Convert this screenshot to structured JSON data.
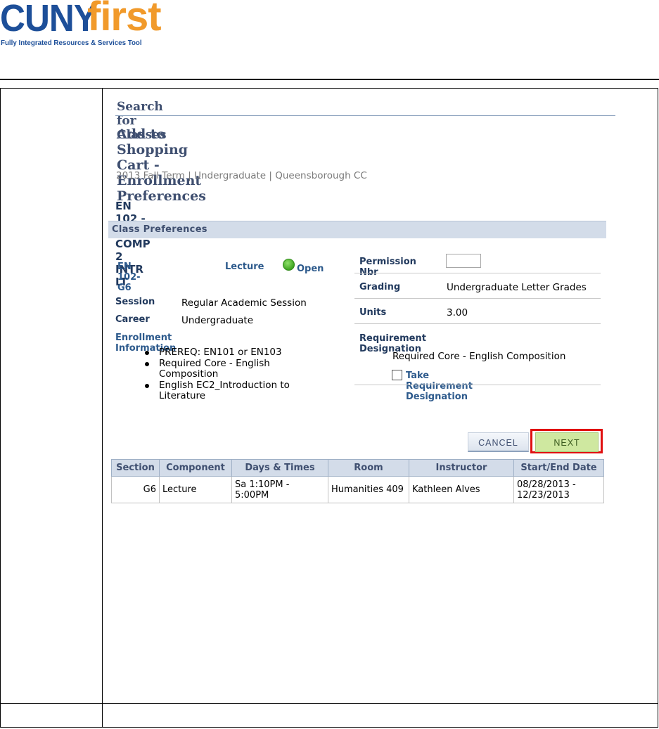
{
  "logo": {
    "brand_part1": "CUNY",
    "brand_part2": "first",
    "tagline": "Fully Integrated Resources & Services Tool",
    "colors": {
      "cuny": "#1d4f99",
      "first": "#f19a2b"
    }
  },
  "page": {
    "header": "Search for Classes",
    "title": "Add to Shopping Cart - Enrollment Preferences",
    "term_line": "2013 Fall Term | Undergraduate | Queensborough CC",
    "class_title": "EN  102 - ENG COMP 2 INTR LT",
    "section_bar": "Class Preferences"
  },
  "class_info": {
    "section_link": "EN  102-G6",
    "component": "Lecture",
    "status_label": "Open",
    "session_label": "Session",
    "session_value": "Regular Academic Session",
    "career_label": "Career",
    "career_value": "Undergraduate",
    "enrollment_info_label": "Enrollment Information",
    "enrollment_info": [
      "PREREQ: EN101 or EN103",
      "Required Core - English Composition",
      "English EC2_Introduction to Literature"
    ]
  },
  "preferences": {
    "permission_label": "Permission Nbr",
    "permission_value": "",
    "grading_label": "Grading",
    "grading_value": "Undergraduate Letter Grades",
    "units_label": "Units",
    "units_value": "3.00",
    "requirement_label": "Requirement Designation",
    "requirement_value": "Required Core - English Composition",
    "take_requirement_label": "Take Requirement Designation",
    "take_requirement_checked": false
  },
  "buttons": {
    "cancel": "CANCEL",
    "next": "NEXT"
  },
  "section_table": {
    "headers": [
      "Section",
      "Component",
      "Days & Times",
      "Room",
      "Instructor",
      "Start/End Date"
    ],
    "rows": [
      {
        "section": "G6",
        "component": "Lecture",
        "days_times": "Sa 1:10PM - 5:00PM",
        "room": "Humanities 409",
        "instructor": "Kathleen Alves",
        "dates": "08/28/2013 - 12/23/2013"
      }
    ]
  }
}
